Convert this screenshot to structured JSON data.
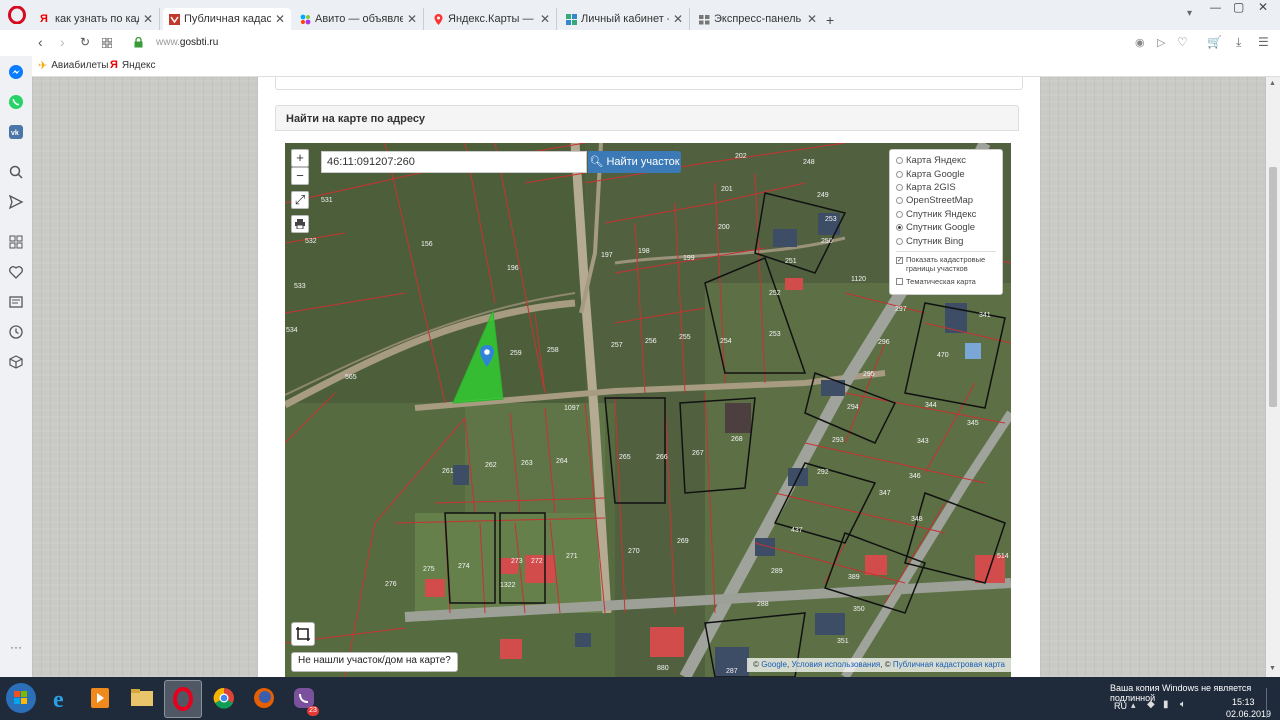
{
  "browser": {
    "tabs": [
      {
        "label": "как узнать по кадастрово",
        "icon": "yandex-icon",
        "active": false
      },
      {
        "label": "Публичная кадастрова",
        "icon": "gosbti-icon",
        "active": true
      },
      {
        "label": "Авито — объявления в Ку",
        "icon": "avito-icon",
        "active": false
      },
      {
        "label": "Яндекс.Карты — выбирай",
        "icon": "map-pin-icon",
        "active": false
      },
      {
        "label": "Личный кабинет - Сообщ",
        "icon": "grid-icon",
        "active": false
      },
      {
        "label": "Экспресс-панель",
        "icon": "speed-dial-icon",
        "active": false
      }
    ],
    "new_tab": "+",
    "url_prefix": "www.",
    "url": "gosbti.ru",
    "bookmarks": [
      {
        "label": "Авиабилеты",
        "icon": "plane-icon"
      },
      {
        "label": "Яндекс",
        "icon": "yandex-icon"
      }
    ]
  },
  "page": {
    "section_title": "Найти на карте по адресу",
    "search": {
      "value": "46:11:091207:260",
      "button_label": "Найти участок"
    },
    "layers": {
      "options": [
        {
          "label": "Карта Яндекс",
          "selected": false
        },
        {
          "label": "Карта Google",
          "selected": false
        },
        {
          "label": "Карта 2GIS",
          "selected": false
        },
        {
          "label": "OpenStreetMap",
          "selected": false
        },
        {
          "label": "Спутник Яндекс",
          "selected": false
        },
        {
          "label": "Спутник Google",
          "selected": true
        },
        {
          "label": "Спутник Bing",
          "selected": false
        }
      ],
      "checkboxes": [
        {
          "label_line1": "Показать кадастровые",
          "label_line2": "границы участков",
          "checked": true
        },
        {
          "label_line1": "Тематическая карта",
          "label_line2": "",
          "checked": false
        }
      ]
    },
    "map_controls": {
      "zoom_in": "+",
      "zoom_out": "−"
    },
    "not_found_label": "Не нашли участок/дом на карте?",
    "attribution": {
      "prefix": "© ",
      "google": "Google",
      "terms": "Условия использования",
      "sep": ", © ",
      "registry": "Публичная кадастровая карта"
    },
    "parcel_labels": [
      "202",
      "248",
      "201",
      "249",
      "197",
      "198",
      "199",
      "200",
      "196",
      "156",
      "531",
      "532",
      "533",
      "534",
      "565",
      "259",
      "258",
      "257",
      "256",
      "255",
      "254",
      "253",
      "252",
      "251",
      "250",
      "253",
      "297",
      "296",
      "295",
      "294",
      "293",
      "292",
      "341",
      "470",
      "344",
      "343",
      "345",
      "347",
      "346",
      "348",
      "437",
      "289",
      "288",
      "389",
      "350",
      "351",
      "1097",
      "268",
      "267",
      "266",
      "265",
      "264",
      "263",
      "262",
      "261",
      "274",
      "273",
      "272",
      "271",
      "270",
      "269",
      "276",
      "275",
      "1322",
      "880",
      "287",
      "514",
      "1120"
    ]
  },
  "taskbar": {
    "lang": "RU",
    "time": "15:13",
    "date": "02.06.2019",
    "watermark": "Ваша копия Windows не является подлинной",
    "viber_badge": "23"
  }
}
